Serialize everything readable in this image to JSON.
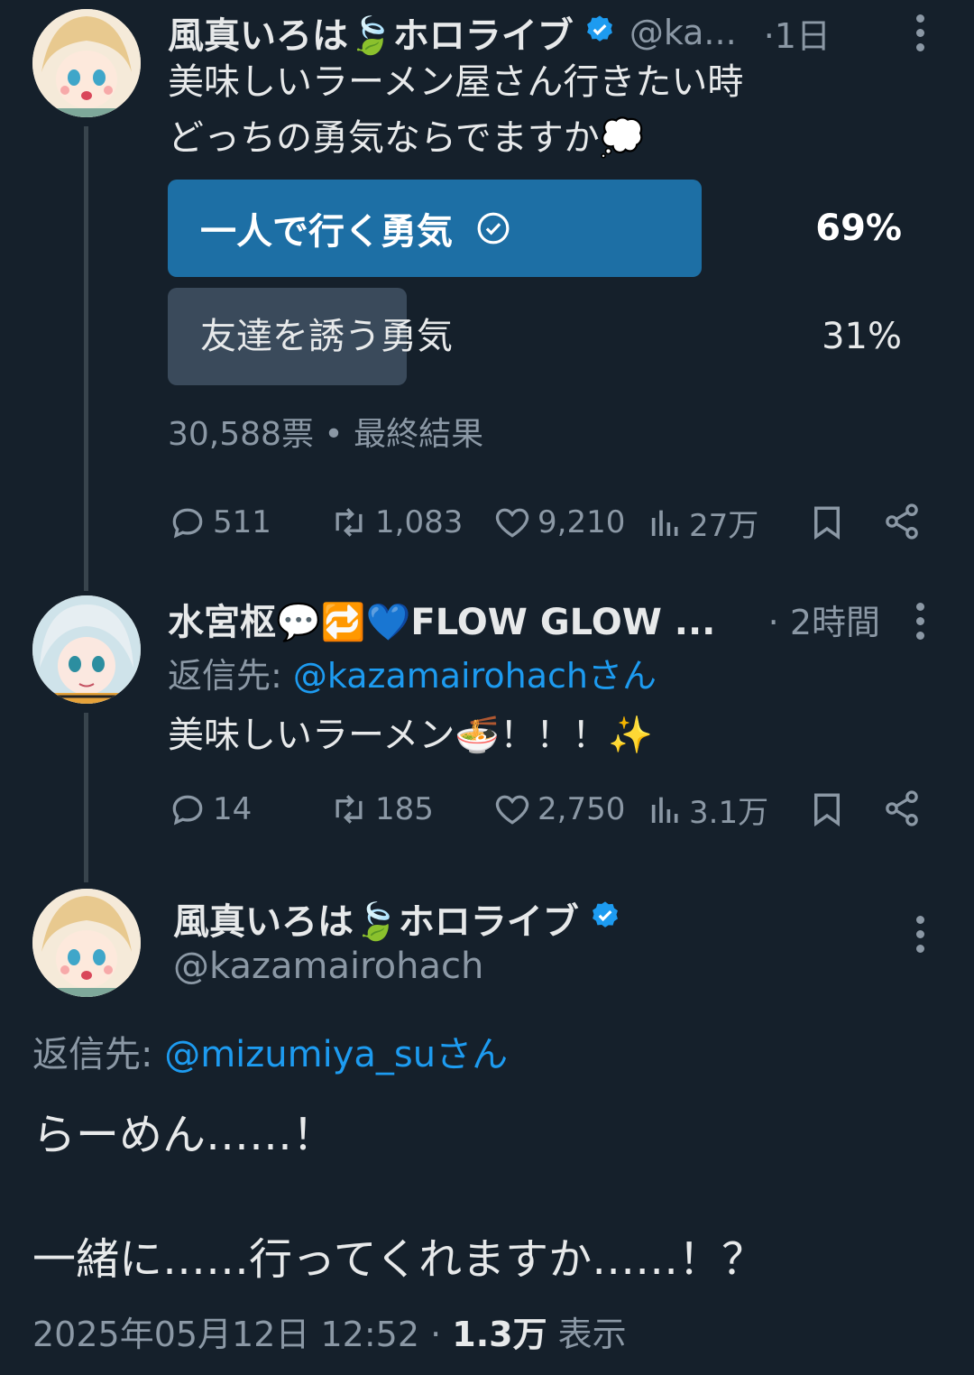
{
  "post1": {
    "name": "風真いろは🍃ホロライブ",
    "handle": "@ka...",
    "time": "·1日",
    "text_line1": "美味しいラーメン屋さん行きたい時",
    "text_line2": "どっちの勇気ならでますか💭",
    "poll": {
      "options": [
        {
          "label": "一人で行く勇気",
          "percent": "69%",
          "value": 69,
          "selected": true
        },
        {
          "label": "友達を誘う勇気",
          "percent": "31%",
          "value": 31,
          "selected": false
        }
      ],
      "summary": "30,588票 • 最終結果"
    },
    "actions": {
      "replies": "511",
      "reposts": "1,083",
      "likes": "9,210",
      "views": "27万"
    }
  },
  "post2": {
    "name": "水宮枢💬🔁💙FLOW GLOW ...",
    "time": "· 2時間",
    "reply_prefix": "返信先: ",
    "reply_to": "@kazamairohachさん",
    "text": "美味しいラーメン🍜！！！✨",
    "actions": {
      "replies": "14",
      "reposts": "185",
      "likes": "2,750",
      "views": "3.1万"
    }
  },
  "post3": {
    "name": "風真いろは🍃ホロライブ",
    "handle": "@kazamairohach",
    "reply_prefix": "返信先: ",
    "reply_to": "@mizumiya_suさん",
    "text_line1": "らーめん……！",
    "text_line2": "一緒に……行ってくれますか……！？",
    "timestamp": "2025年05月12日 12:52 · ",
    "views_count": "1.3万",
    "views_label": " 表示"
  },
  "colors": {
    "background": "#15202b",
    "accent": "#1d9bf0",
    "poll_selected": "#1d6fa5",
    "poll_other": "#3a4a5b",
    "muted": "#8b98a5"
  }
}
